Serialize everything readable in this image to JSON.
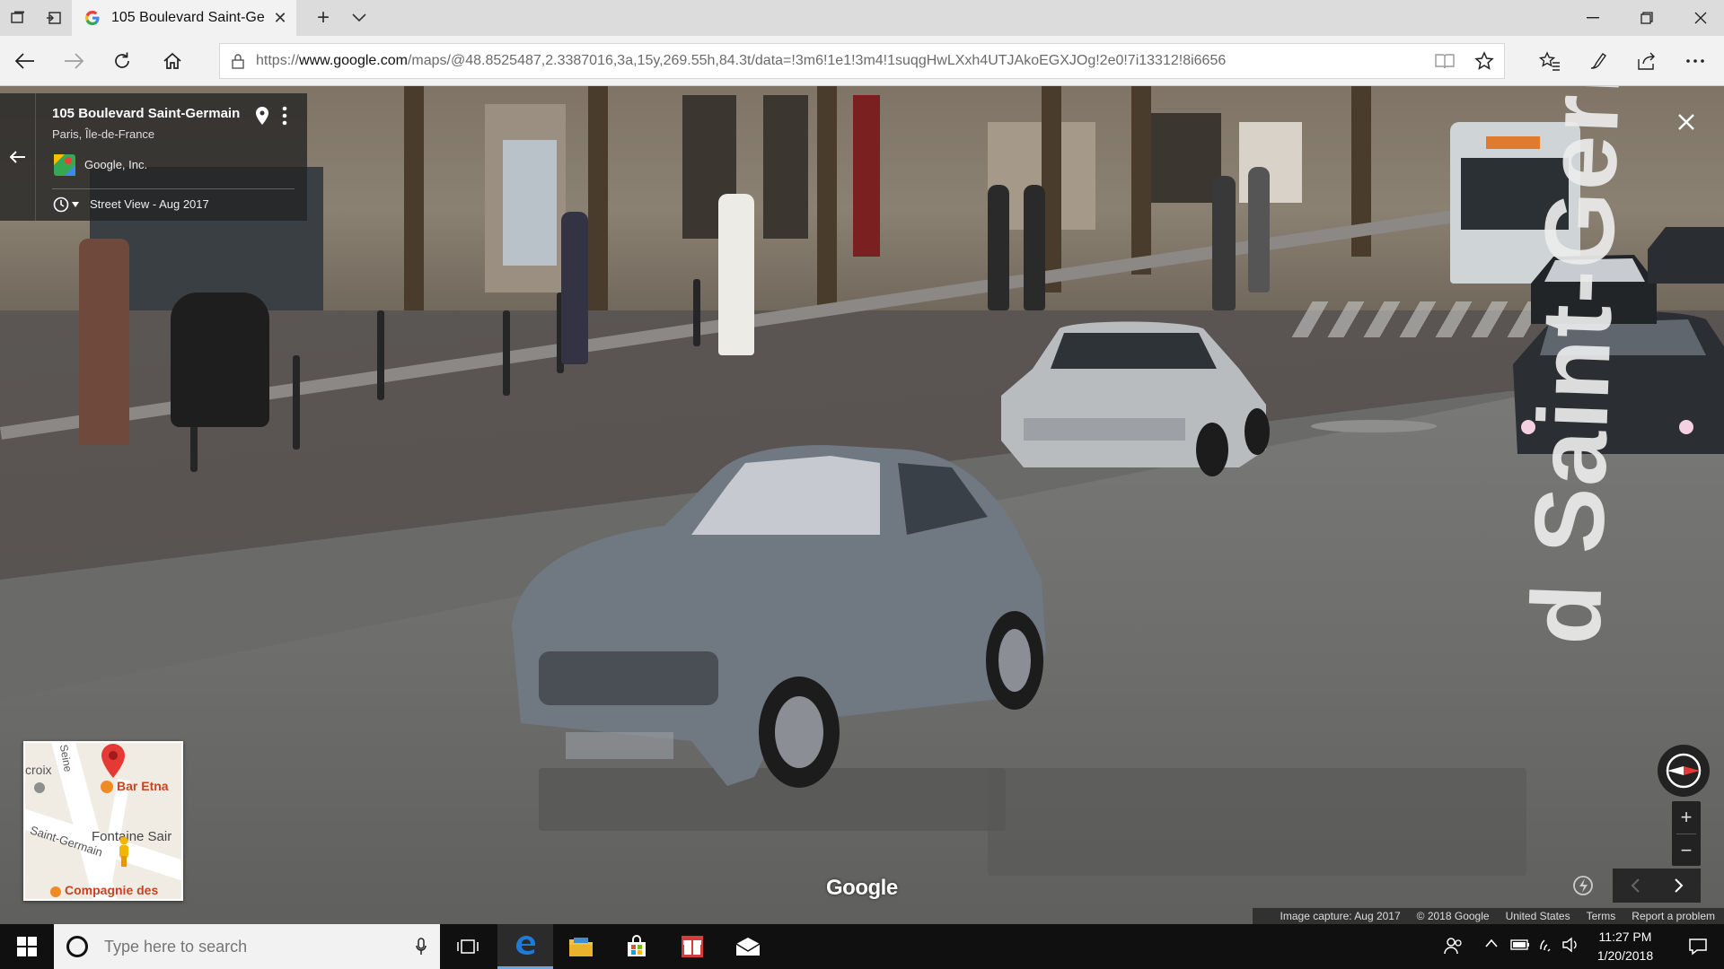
{
  "browser": {
    "tab_title": "105 Boulevard Saint-Ge",
    "url_prefix": "https://",
    "url_domain": "www.google.com",
    "url_path": "/maps/@48.8525487,2.3387016,3a,15y,269.55h,84.3t/data=!3m6!1e1!3m4!1suqgHwLXxh4UTJAkoEGXJOg!2e0!7i13312!8i6656"
  },
  "info_panel": {
    "title": "105 Boulevard Saint-Germain",
    "subtitle": "Paris, Île-de-France",
    "owner": "Google, Inc.",
    "street_view_date": "Street View - Aug 2017"
  },
  "minimap": {
    "label_croix": "croix",
    "label_seine": "Seine",
    "poi_bar": "Bar Etna",
    "label_fontaine": "Fontaine Sair",
    "label_saint_germain": "Saint-Germain",
    "poi_compagnie": "Compagnie des"
  },
  "scene": {
    "street_label": "d Saint-Germain",
    "google_logo": "Google"
  },
  "footer": {
    "capture": "Image capture: Aug 2017",
    "copyright": "© 2018 Google",
    "country": "United States",
    "terms": "Terms",
    "report": "Report a problem"
  },
  "taskbar": {
    "search_placeholder": "Type here to search",
    "time": "11:27 PM",
    "date": "1/20/2018"
  },
  "colors": {
    "panel_bg": "#222222",
    "taskbar_bg": "#101010",
    "edge_blue": "#1e7bd6",
    "poi_orange": "#c8441e",
    "pin_red": "#e53935"
  }
}
